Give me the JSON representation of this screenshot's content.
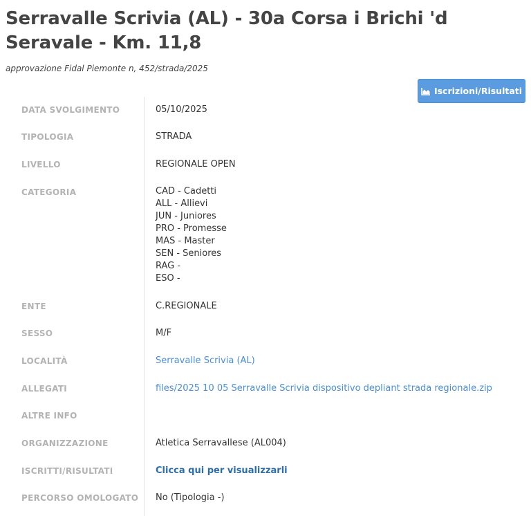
{
  "header": {
    "title": "Serravalle Scrivia (AL) - 30a Corsa i Brichi 'd Seravale - Km. 11,8",
    "subtitle": "approvazione Fidal Piemonte n, 452/strada/2025"
  },
  "actions": {
    "results_button_label": "Iscrizioni/Risultati",
    "results_button_icon": "area-chart-icon"
  },
  "details": {
    "data_svolgimento": {
      "label": "DATA SVOLGIMENTO",
      "value": "05/10/2025"
    },
    "tipologia": {
      "label": "TIPOLOGIA",
      "value": "STRADA"
    },
    "livello": {
      "label": "LIVELLO",
      "value": "REGIONALE OPEN"
    },
    "categoria": {
      "label": "CATEGORIA",
      "values": [
        "CAD - Cadetti",
        "ALL - Allievi",
        "JUN - Juniores",
        "PRO - Promesse",
        "MAS - Master",
        "SEN - Seniores",
        "RAG -",
        "ESO -"
      ]
    },
    "ente": {
      "label": "ENTE",
      "value": "C.REGIONALE"
    },
    "sesso": {
      "label": "SESSO",
      "value": "M/F"
    },
    "localita": {
      "label": "LOCALITÀ",
      "value": "Serravalle Scrivia (AL)"
    },
    "allegati": {
      "label": "ALLEGATI",
      "value": "files/2025 10 05 Serravalle Scrivia dispositivo depliant strada regionale.zip"
    },
    "altre_info": {
      "label": "ALTRE INFO",
      "value": ""
    },
    "organizzazione": {
      "label": "ORGANIZZAZIONE",
      "value": "Atletica Serravallese (AL004)"
    },
    "iscritti_risultati": {
      "label": "ISCRITTI/RISULTATI",
      "value": "Clicca qui per visualizzarli"
    },
    "percorso_omologato": {
      "label": "PERCORSO OMOLOGATO",
      "value": "No (Tipologia -)"
    }
  },
  "colors": {
    "button_bg": "#5b9be0",
    "link": "#4a8fd4",
    "label_gray": "#b3b3b3"
  }
}
